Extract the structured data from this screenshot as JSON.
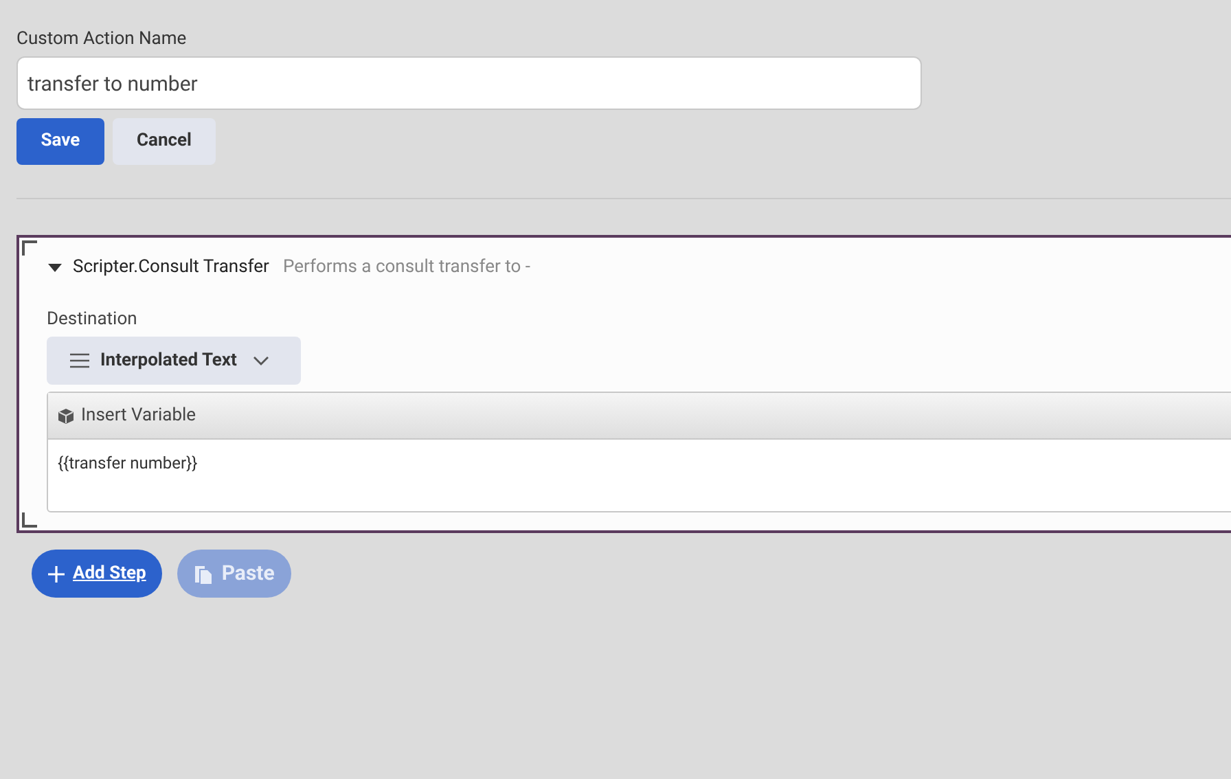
{
  "name_field": {
    "label": "Custom Action Name",
    "value": "transfer to number"
  },
  "actions": [
    {
      "label": "Save",
      "kind": "primary"
    },
    {
      "label": "Cancel",
      "kind": "secondary"
    }
  ],
  "step": {
    "expanded": true,
    "title": "Scripter.Consult Transfer",
    "description": "Performs a consult transfer to -",
    "destination": {
      "label": "Destination",
      "mode": "Interpolated Text",
      "toolbar_button": "Insert Variable",
      "value": "{{transfer number}}"
    }
  },
  "footer_buttons": [
    {
      "label": "Add Step",
      "kind": "add",
      "disabled": false
    },
    {
      "label": "Paste",
      "kind": "paste",
      "disabled": true
    }
  ]
}
